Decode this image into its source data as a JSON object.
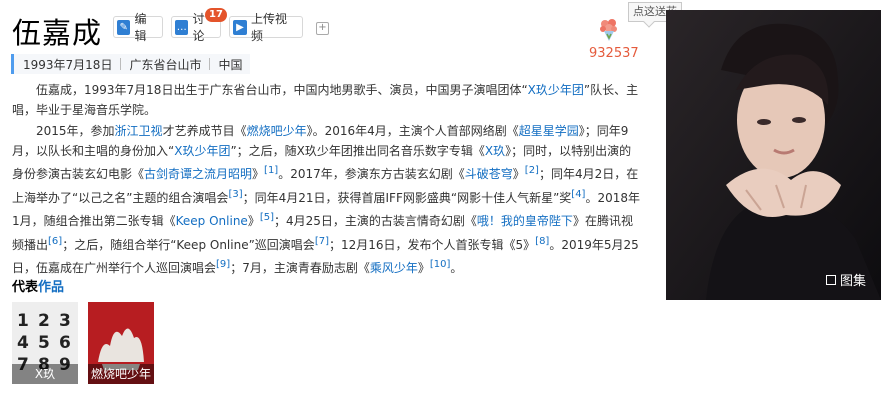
{
  "title": "伍嘉成",
  "toolbar": {
    "edit_label": "编辑",
    "discuss_label": "讨论",
    "discuss_count": "17",
    "upload_label": "上传视频"
  },
  "flower": {
    "count": "932537",
    "tooltip": "点这送花"
  },
  "meta": {
    "birth": "1993年7月18日",
    "place": "广东省台山市",
    "country": "中国"
  },
  "intro": {
    "p1": "伍嘉成，1993年7月18日出生于广东省台山市，中国内地男歌手、演员，中国男子演唱团体“",
    "p1_link": "X玖少年团",
    "p1_end": "”队长、主唱，毕业于星海音乐学院。"
  },
  "career": {
    "s1": "2015年，参加",
    "l1": "浙江卫视",
    "s2": "才艺养成节目《",
    "l2": "燃烧吧少年",
    "s3": "》。2016年4月，主演个人首部网络剧《",
    "l3": "超星星学园",
    "s4": "》；同年9月，以队长和主唱的身份加入“",
    "l4": "X玖少年团",
    "s5": "”；之后，随X玖少年团推出同名音乐数字专辑《",
    "l5": "X玖",
    "s6": "》；同时，以特别出演的身份参演古装玄幻电影《",
    "l6": "古剑奇谭之流月昭明",
    "s7": "》",
    "r1": "[1]",
    "s8": "。2017年，参演东方古装玄幻剧《",
    "l7": "斗破苍穹",
    "s9": "》",
    "r2": "[2]",
    "s10": "；同年4月2日，在上海举办了“以己之名”主题的组合演唱会",
    "r3": "[3]",
    "s11": "；同年4月21日，获得首届IFF网影盛典“网影十佳人气新星”奖",
    "r4": "[4]",
    "s12": "。2018年1月，随组合推出第二张专辑《",
    "l8": "Keep Online",
    "s13": "》",
    "r5": "[5]",
    "s14": "；4月25日，主演的古装言情奇幻剧《",
    "l9": "哦！我的皇帝陛下",
    "s15": "》在腾讯视频播出",
    "r6": "[6]",
    "s16": "；之后，随组合举行“Keep Online”巡回演唱会",
    "r7": "[7]",
    "s17": "；12月16日，发布个人首张专辑《5》",
    "r8": "[8]",
    "s18": "。2019年5月25日，伍嘉成在广州举行个人巡回演唱会",
    "r9": "[9]",
    "s19": "；7月，主演青春励志剧《",
    "l10": "乘风少年",
    "s20": "》",
    "r10": "[10]",
    "s21": "。"
  },
  "works": {
    "heading_a": "代表",
    "heading_b": "作品",
    "items": [
      {
        "caption": "X玖"
      },
      {
        "caption": "燃烧吧少年"
      }
    ]
  },
  "gallery_label": "图集",
  "colors": {
    "link": "#136ec2",
    "accent_bar": "#4f9cee",
    "flower_count": "#e55b3c",
    "badge": "#e4542b"
  },
  "icons": [
    "edit-icon",
    "discuss-icon",
    "upload-video-icon",
    "plus-icon",
    "flower-icon",
    "gallery-icon"
  ]
}
